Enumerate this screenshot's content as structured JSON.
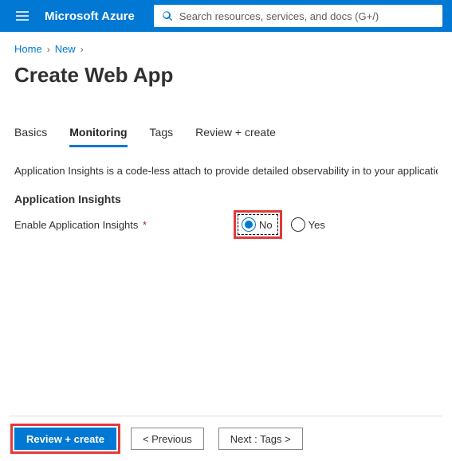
{
  "header": {
    "brand": "Microsoft Azure",
    "search_placeholder": "Search resources, services, and docs (G+/)"
  },
  "breadcrumb": {
    "items": [
      "Home",
      "New"
    ]
  },
  "title": "Create Web App",
  "tabs": {
    "items": [
      "Basics",
      "Monitoring",
      "Tags",
      "Review + create"
    ],
    "active": "Monitoring"
  },
  "description": "Application Insights is a code-less attach to provide detailed observability in to your application.",
  "section": {
    "heading": "Application Insights",
    "field_label": "Enable Application Insights",
    "required": "*",
    "options": {
      "no": "No",
      "yes": "Yes"
    },
    "selected": "no"
  },
  "footer": {
    "review": "Review + create",
    "previous": "< Previous",
    "next": "Next : Tags >"
  }
}
